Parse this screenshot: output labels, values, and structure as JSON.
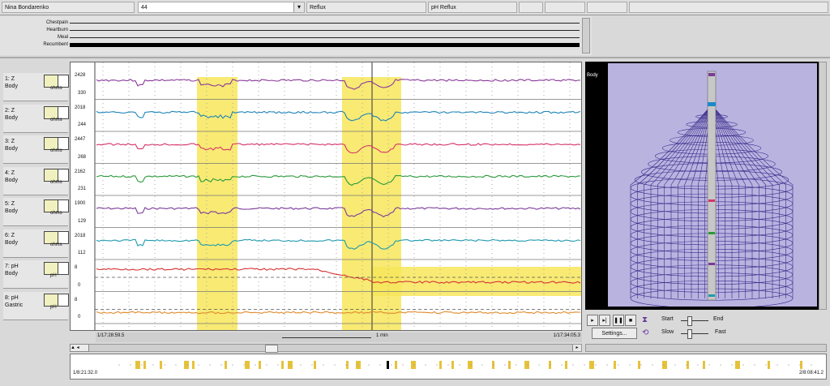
{
  "header": {
    "patient": "Nina Bondarenko",
    "study_select": "44",
    "col_reflux": "Reflux",
    "col_ph_reflux": "pH Reflux"
  },
  "events": [
    "Chestpain",
    "Heartburn",
    "Meal",
    "Recumbent"
  ],
  "channels": [
    {
      "line1": "1: Z",
      "line2": "Body",
      "unit": "ohms",
      "ymax": "2428",
      "ymin": "330",
      "color": "#8a3a9a"
    },
    {
      "line1": "2: Z",
      "line2": "Body",
      "unit": "ohms",
      "ymax": "2018",
      "ymin": "244",
      "color": "#1f84b8"
    },
    {
      "line1": "3: Z",
      "line2": "Body",
      "unit": "ohms",
      "ymax": "2447",
      "ymin": "268",
      "color": "#d6336b"
    },
    {
      "line1": "4: Z",
      "line2": "Body",
      "unit": "ohms",
      "ymax": "2162",
      "ymin": "231",
      "color": "#2a9a3a"
    },
    {
      "line1": "5: Z",
      "line2": "Body",
      "unit": "ohms",
      "ymax": "1900",
      "ymin": "129",
      "color": "#7a3a9a"
    },
    {
      "line1": "6: Z",
      "line2": "Body",
      "unit": "ohms",
      "ymax": "2018",
      "ymin": "112",
      "color": "#1f9ab0"
    },
    {
      "line1": "7: pH",
      "line2": "Body",
      "unit": "pH",
      "ymax": "8",
      "ymin": "0",
      "color": "#d63333"
    },
    {
      "line1": "8: pH",
      "line2": "Gastric",
      "unit": "pH",
      "ymax": "8",
      "ymin": "0",
      "color": "#e08a2a"
    }
  ],
  "time_start": "1/17:28:59.5",
  "time_end": "1/17:34:05.3",
  "scale_label": "1 min",
  "view": {
    "title": "Body",
    "start_label": "Start",
    "end_label": "End",
    "slow_label": "Slow",
    "fast_label": "Fast",
    "settings_label": "Settings..."
  },
  "timeline": {
    "start": "1/8:21:32.0",
    "end": "2/8:08:41.2"
  },
  "colors": {
    "highlight": "#f7e65a",
    "mesh": "#3a2a8a",
    "view_bg": "#b9b3e0"
  }
}
